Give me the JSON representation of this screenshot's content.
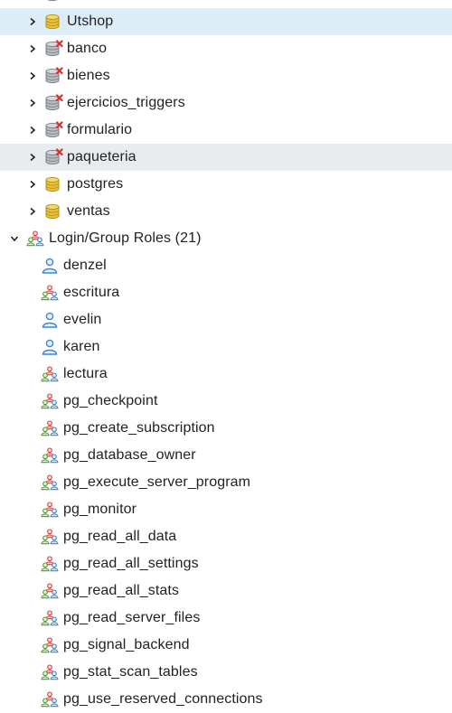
{
  "colors": {
    "selected_row": "#dcedf8",
    "hover_row": "#e9ecef",
    "db_gold": "#e9c23a",
    "db_gray": "#9aa0a6",
    "error_red": "#d9302c",
    "role_blue": "#3b86d3"
  },
  "databases": [
    {
      "name": "Utshop",
      "icon": "database-icon",
      "state": "connected",
      "selected": true
    },
    {
      "name": "banco",
      "icon": "database-disconnected-icon",
      "state": "disconnected"
    },
    {
      "name": "bienes",
      "icon": "database-disconnected-icon",
      "state": "disconnected"
    },
    {
      "name": "ejercicios_triggers",
      "icon": "database-disconnected-icon",
      "state": "disconnected"
    },
    {
      "name": "formulario",
      "icon": "database-disconnected-icon",
      "state": "disconnected"
    },
    {
      "name": "paqueteria",
      "icon": "database-disconnected-icon",
      "state": "disconnected",
      "hovered": true
    },
    {
      "name": "postgres",
      "icon": "database-icon",
      "state": "connected"
    },
    {
      "name": "ventas",
      "icon": "database-icon",
      "state": "connected"
    }
  ],
  "roles_group": {
    "label": "Login/Group Roles (21)",
    "icon": "group-roles-icon",
    "expanded": true
  },
  "roles": [
    {
      "name": "denzel",
      "type": "login"
    },
    {
      "name": "escritura",
      "type": "group"
    },
    {
      "name": "evelin",
      "type": "login"
    },
    {
      "name": "karen",
      "type": "login"
    },
    {
      "name": "lectura",
      "type": "group"
    },
    {
      "name": "pg_checkpoint",
      "type": "group"
    },
    {
      "name": "pg_create_subscription",
      "type": "group"
    },
    {
      "name": "pg_database_owner",
      "type": "group"
    },
    {
      "name": "pg_execute_server_program",
      "type": "group"
    },
    {
      "name": "pg_monitor",
      "type": "group"
    },
    {
      "name": "pg_read_all_data",
      "type": "group"
    },
    {
      "name": "pg_read_all_settings",
      "type": "group"
    },
    {
      "name": "pg_read_all_stats",
      "type": "group"
    },
    {
      "name": "pg_read_server_files",
      "type": "group"
    },
    {
      "name": "pg_signal_backend",
      "type": "group"
    },
    {
      "name": "pg_stat_scan_tables",
      "type": "group"
    },
    {
      "name": "pg_use_reserved_connections",
      "type": "group"
    }
  ]
}
